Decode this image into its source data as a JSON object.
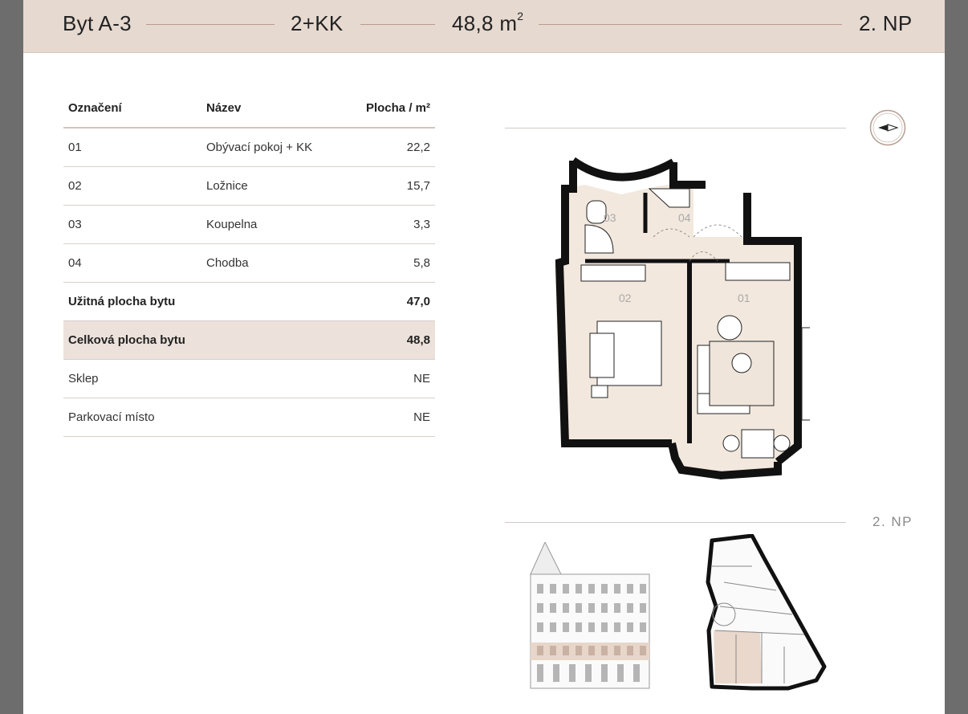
{
  "header": {
    "unit": "Byt A-3",
    "layout": "2+KK",
    "area": "48,8 m",
    "area_sup": "2",
    "floor": "2. NP"
  },
  "table": {
    "headers": {
      "code": "Označení",
      "name": "Název",
      "area": "Plocha / m²"
    },
    "rooms": [
      {
        "code": "01",
        "name": "Obývací pokoj + KK",
        "area": "22,2"
      },
      {
        "code": "02",
        "name": "Ložnice",
        "area": "15,7"
      },
      {
        "code": "03",
        "name": "Koupelna",
        "area": "3,3"
      },
      {
        "code": "04",
        "name": "Chodba",
        "area": "5,8"
      }
    ],
    "usable": {
      "label": "Užitná plocha bytu",
      "value": "47,0"
    },
    "total": {
      "label": "Celková plocha bytu",
      "value": "48,8"
    },
    "cellar": {
      "label": "Sklep",
      "value": "NE"
    },
    "parking": {
      "label": "Parkovací místo",
      "value": "NE"
    }
  },
  "plan": {
    "room_labels": [
      "03",
      "04",
      "02",
      "01"
    ],
    "floor_label": "2. NP"
  },
  "colors": {
    "header_bg": "#e6d9d0",
    "highlight_row": "#ece2db",
    "plan_fill": "#f2e8de",
    "accent_line": "#b99a8b"
  },
  "icons": [
    "compass-icon",
    "floor-plan-drawing",
    "building-facade-drawing",
    "floor-key-plan"
  ]
}
